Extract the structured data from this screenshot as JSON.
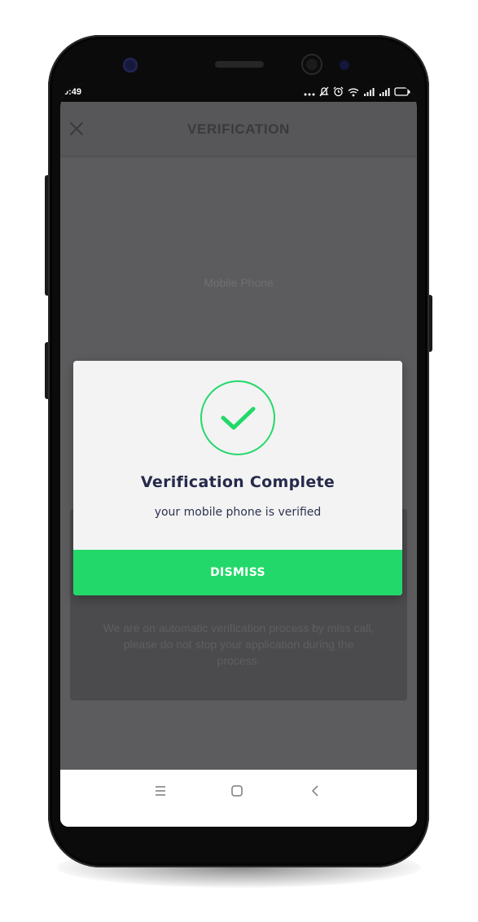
{
  "status_bar": {
    "time": "0:49",
    "icons": [
      "more-dots-icon",
      "mute-icon",
      "alarm-icon",
      "wifi-icon",
      "signal-icon",
      "signal-icon",
      "battery-icon"
    ]
  },
  "header": {
    "title": "VERIFICATION",
    "close_icon": "close-icon"
  },
  "main": {
    "phone_label": "Mobile Phone",
    "info_text": "We are on automatic verification process by miss call, please do not stop your application during the process."
  },
  "dialog": {
    "icon": "check-circle-icon",
    "title": "Verification Complete",
    "subtitle": "your mobile phone is verified",
    "dismiss_label": "DISMISS"
  },
  "nav_bar": {
    "buttons": [
      "recent-apps-icon",
      "home-icon",
      "back-icon"
    ]
  },
  "colors": {
    "accent_green": "#23d86a",
    "overlay": "#5c5c5e",
    "dialog_bg": "#f3f3f3",
    "dialog_text": "#262a4a"
  }
}
